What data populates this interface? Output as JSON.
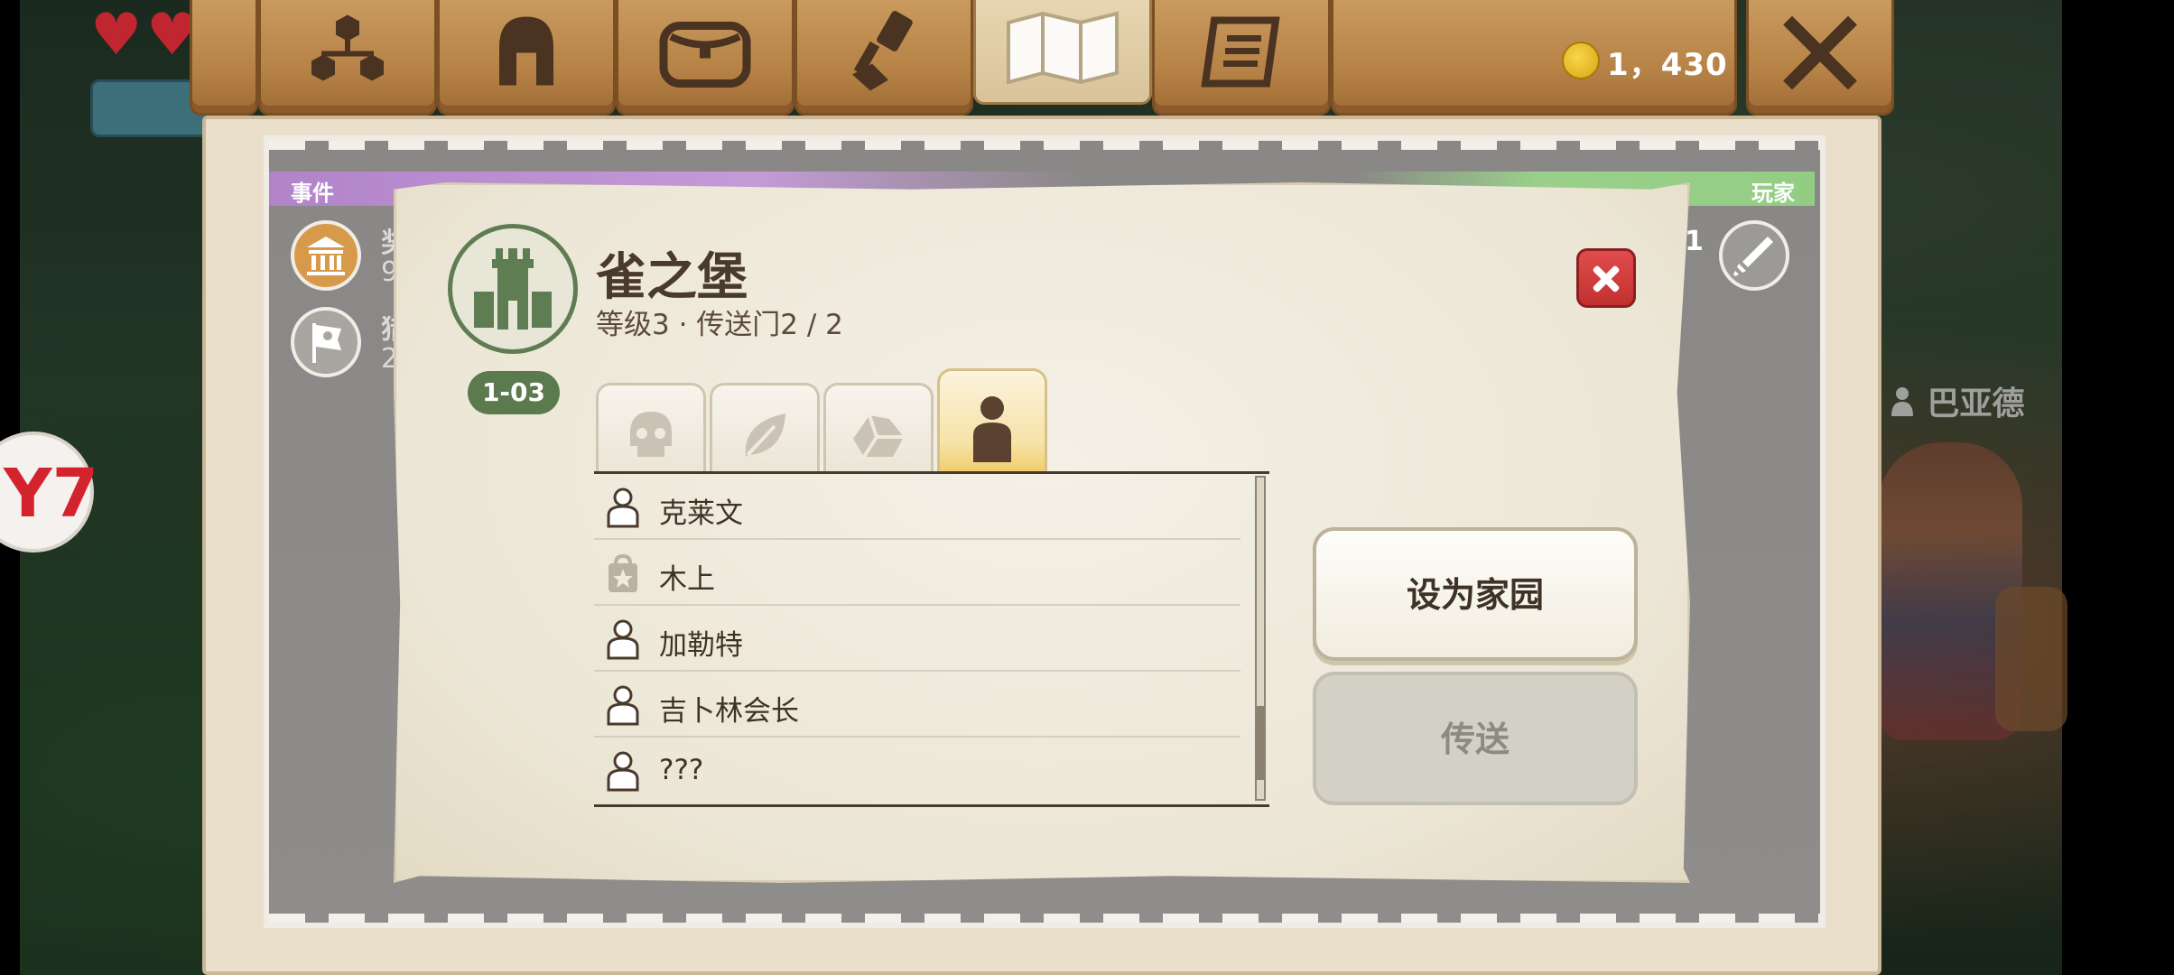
{
  "hud": {
    "hearts": [
      "heart-icon",
      "heart-icon"
    ],
    "app_badge_glyph": "Y7",
    "npc_name": "巴亚德"
  },
  "top_tabs": [
    {
      "name": "group",
      "icon": "network-icon"
    },
    {
      "name": "equipment",
      "icon": "helmet-icon"
    },
    {
      "name": "inventory",
      "icon": "bag-icon"
    },
    {
      "name": "crafting",
      "icon": "hammer-icon"
    },
    {
      "name": "map",
      "icon": "map-icon",
      "active": true
    },
    {
      "name": "quests",
      "icon": "scroll-icon"
    }
  ],
  "currency": {
    "value": "1，430",
    "icon": "coin-icon"
  },
  "map": {
    "events_label": "事件",
    "players_label": "玩家",
    "event_fragments": [
      "奖",
      "9",
      "猎",
      "2"
    ],
    "player_count": "1"
  },
  "location": {
    "name": "雀之堡",
    "subtitle": "等级3 · 传送门2 / 2",
    "code": "1-03",
    "icon": "castle-tower-icon"
  },
  "category_tabs": [
    {
      "name": "monsters",
      "icon": "skull-icon"
    },
    {
      "name": "plants",
      "icon": "leaf-icon"
    },
    {
      "name": "ores",
      "icon": "rock-icon"
    },
    {
      "name": "npcs",
      "icon": "person-icon",
      "active": true
    }
  ],
  "npc_list": [
    {
      "icon": "person-icon",
      "label": "克莱文"
    },
    {
      "icon": "shop-bag-icon",
      "label": "木上"
    },
    {
      "icon": "person-icon",
      "label": "加勒特"
    },
    {
      "icon": "person-icon",
      "label": "吉卜林会长"
    },
    {
      "icon": "person-icon",
      "label": "???"
    }
  ],
  "list_scroll": {
    "position_fraction": 0.93
  },
  "actions": {
    "set_home": "设为家园",
    "teleport": "传送"
  },
  "colors": {
    "wood": "#b78347",
    "parchment": "#efeadd",
    "location_green": "#5b7b4e",
    "close_red": "#c23030",
    "events_band": "#b184c9",
    "players_band": "#93cd84"
  }
}
